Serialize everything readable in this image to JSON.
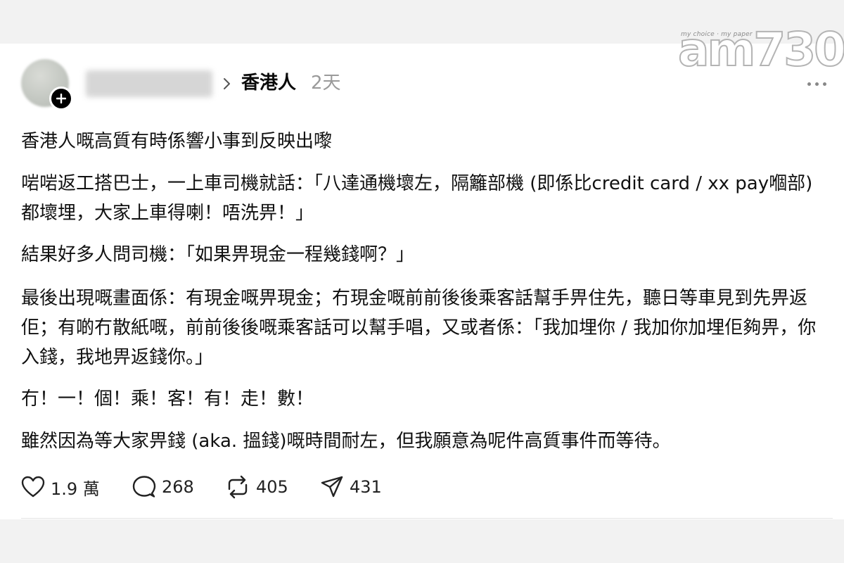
{
  "post": {
    "community": "香港人",
    "time_ago": "2天",
    "paragraphs": [
      "香港人嘅高質有時係響小事到反映出嚟",
      "啱啱返工搭巴士，一上車司機就話：「八達通機壞左，隔籬部機 (即係比credit card / xx pay嗰部) 都壞埋，大家上車得喇！唔洗畀！」",
      "結果好多人問司機：「如果畀現金一程幾錢啊？」",
      "最後出現嘅畫面係：有現金嘅畀現金；冇現金嘅前前後後乘客話幫手畀住先，聽日等車見到先畀返佢；有啲冇散紙嘅，前前後後嘅乘客話可以幫手唱，又或者係：「我加埋你 / 我加你加埋佢夠畀，你入錢，我地畀返錢你。」",
      "冇！一！個！乘！客！有！走！數！",
      "雖然因為等大家畀錢 (aka. 搵錢)嘅時間耐左，但我願意為呢件高質事件而等待。"
    ]
  },
  "actions": {
    "likes": "1.9 萬",
    "comments": "268",
    "reposts": "405",
    "shares": "431"
  },
  "logo": {
    "tagline": "my choice · my paper",
    "text": "am730"
  },
  "icons": {
    "follow": "plus-icon",
    "chevron": "chevron-right-icon",
    "more": "more-horizontal-icon",
    "like": "heart-icon",
    "comment": "comment-icon",
    "repost": "repost-icon",
    "share": "send-icon"
  }
}
